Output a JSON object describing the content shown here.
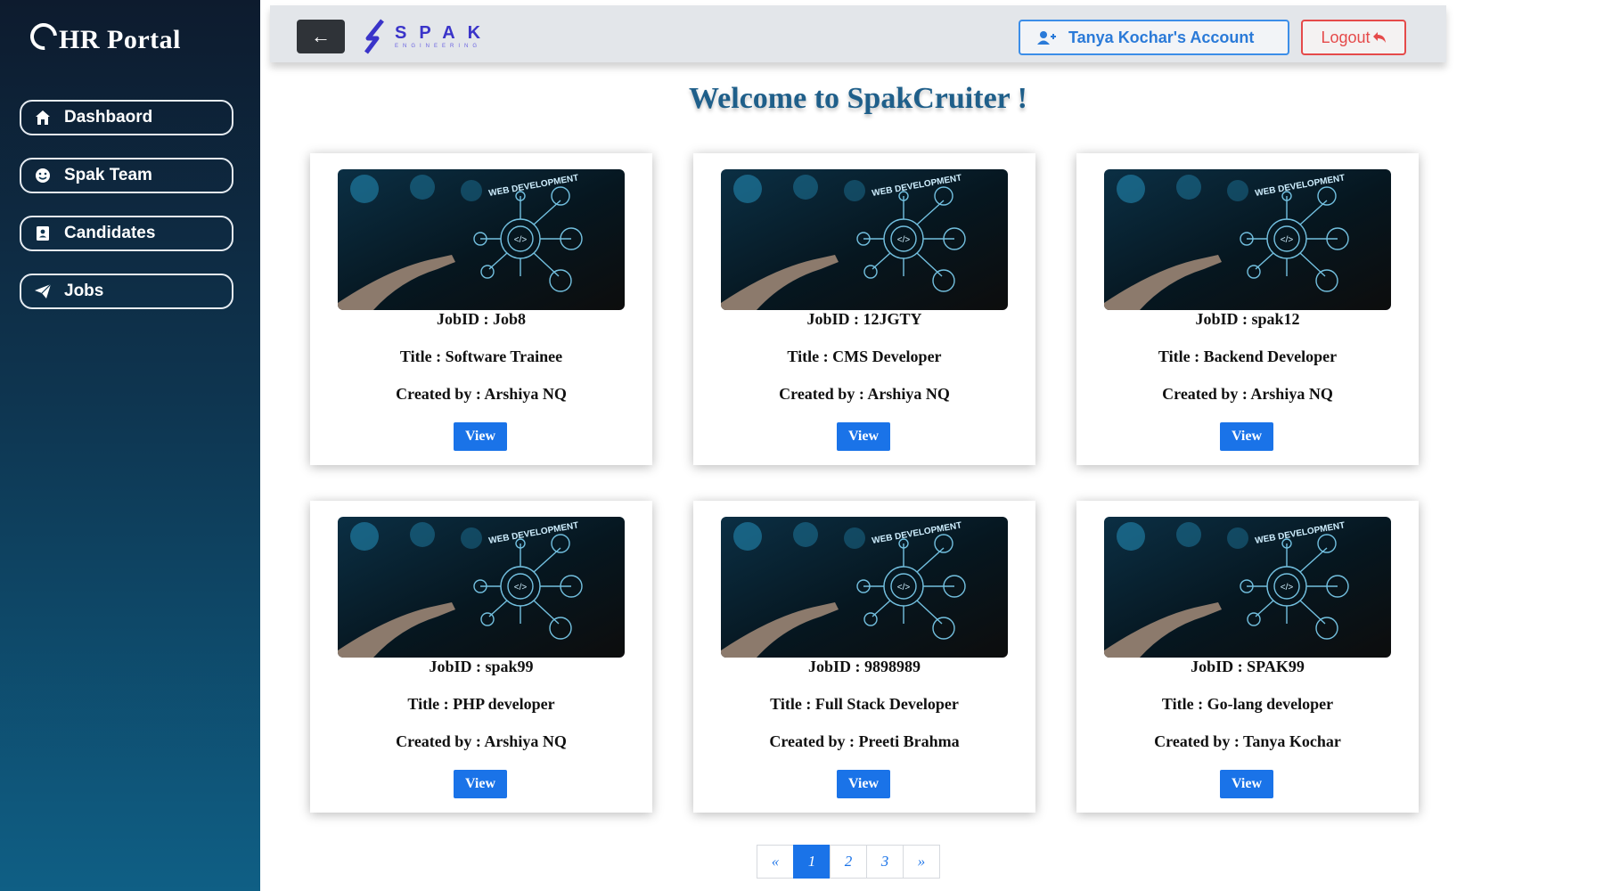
{
  "sidebar": {
    "brand": "HR Portal",
    "items": [
      {
        "label": "Dashbaord",
        "icon": "home-icon"
      },
      {
        "label": "Spak Team",
        "icon": "smiley-icon"
      },
      {
        "label": "Candidates",
        "icon": "contact-book-icon"
      },
      {
        "label": "Jobs",
        "icon": "paper-plane-icon"
      }
    ]
  },
  "topbar": {
    "back_label": "←",
    "logo_word": "SPAK",
    "logo_sub": "ENGINEERING",
    "account_label": "Tanya Kochar's Account",
    "logout_label": "Logout"
  },
  "heading": "Welcome to SpakCruiter !",
  "jobs": [
    {
      "jobid": "JobID : Job8",
      "title": "Title : Software Trainee",
      "created": "Created by : Arshiya NQ",
      "view": "View",
      "image_text": "WEB DEVELOPMENT"
    },
    {
      "jobid": "JobID : 12JGTY",
      "title": "Title : CMS Developer",
      "created": "Created by : Arshiya NQ",
      "view": "View",
      "image_text": "WEB DEVELOPMENT"
    },
    {
      "jobid": "JobID : spak12",
      "title": "Title : Backend Developer",
      "created": "Created by : Arshiya NQ",
      "view": "View",
      "image_text": "WEB DEVELOPMENT"
    },
    {
      "jobid": "JobID : spak99",
      "title": "Title : PHP developer",
      "created": "Created by : Arshiya NQ",
      "view": "View",
      "image_text": "WEB DEVELOPMENT"
    },
    {
      "jobid": "JobID : 9898989",
      "title": "Title : Full Stack Developer",
      "created": "Created by : Preeti Brahma",
      "view": "View",
      "image_text": "WEB DEVELOPMENT"
    },
    {
      "jobid": "JobID : SPAK99",
      "title": "Title : Go-lang developer",
      "created": "Created by : Tanya Kochar",
      "view": "View",
      "image_text": "WEB DEVELOPMENT"
    }
  ],
  "pagination": {
    "prev": "«",
    "pages": [
      "1",
      "2",
      "3"
    ],
    "next": "»",
    "current": "1"
  },
  "colors": {
    "accent": "#1a73e8",
    "heading": "#1f5f8a",
    "logout": "#e54a4a",
    "sidebar_top": "#0d1b2e",
    "sidebar_bottom": "#0f5f85"
  }
}
